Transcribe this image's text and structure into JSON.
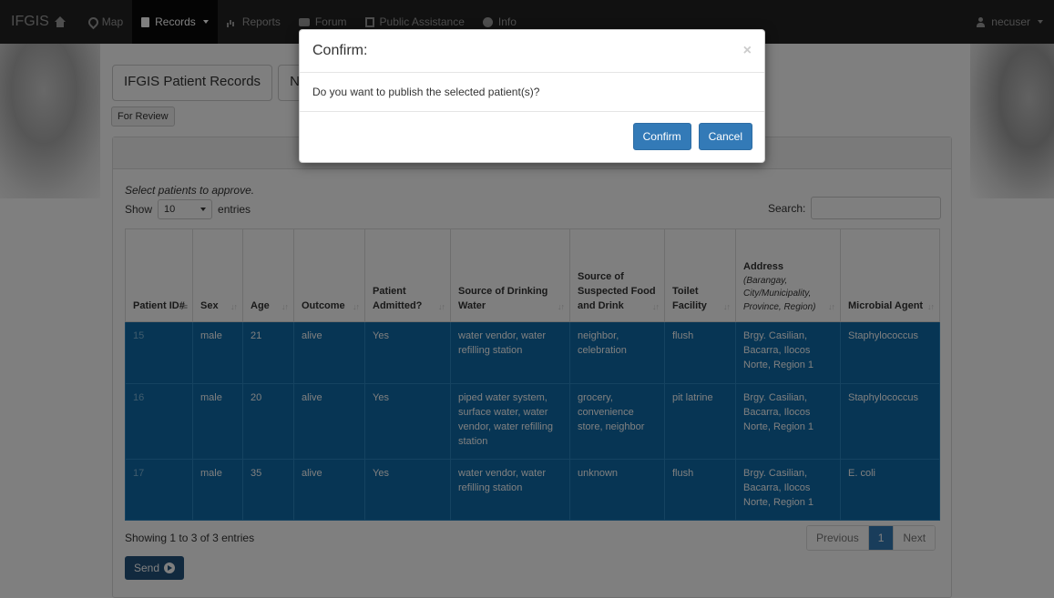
{
  "navbar": {
    "brand": "IFGIS",
    "items": [
      {
        "label": "Map",
        "icon": "map-marker-icon"
      },
      {
        "label": "Records",
        "icon": "book-icon"
      },
      {
        "label": "Reports",
        "icon": "bar-chart-icon"
      },
      {
        "label": "Forum",
        "icon": "comment-icon"
      },
      {
        "label": "Public Assistance",
        "icon": "list-alt-icon"
      },
      {
        "label": "Info",
        "icon": "question-sign-icon"
      }
    ],
    "user": "necuser"
  },
  "page": {
    "tabs": [
      "IFGIS Patient Records",
      "N"
    ],
    "for_review": "For Review",
    "hint": "Select patients to approve.",
    "show_label": "Show",
    "entries_value": "10",
    "entries_label": "entries",
    "search_label": "Search:"
  },
  "table": {
    "headers": [
      {
        "label": "Patient ID#",
        "sub": ""
      },
      {
        "label": "Sex",
        "sub": ""
      },
      {
        "label": "Age",
        "sub": ""
      },
      {
        "label": "Outcome",
        "sub": ""
      },
      {
        "label": "Patient Admitted?",
        "sub": ""
      },
      {
        "label": "Source of Drinking Water",
        "sub": ""
      },
      {
        "label": "Source of Suspected Food and Drink",
        "sub": ""
      },
      {
        "label": "Toilet Facility",
        "sub": ""
      },
      {
        "label": "Address",
        "sub": "(Barangay, City/Municipality, Province, Region)"
      },
      {
        "label": "Microbial Agent",
        "sub": ""
      }
    ],
    "rows": [
      [
        "15",
        "male",
        "21",
        "alive",
        "Yes",
        "water vendor, water refilling station",
        "neighbor, celebration",
        "flush",
        "Brgy. Casilian, Bacarra, Ilocos Norte, Region 1",
        "Staphylococcus"
      ],
      [
        "16",
        "male",
        "20",
        "alive",
        "Yes",
        "piped water system, surface water, water vendor, water refilling station",
        "grocery, convenience store, neighbor",
        "pit latrine",
        "Brgy. Casilian, Bacarra, Ilocos Norte, Region 1",
        "Staphylococcus"
      ],
      [
        "17",
        "male",
        "35",
        "alive",
        "Yes",
        "water vendor, water refilling station",
        "unknown",
        "flush",
        "Brgy. Casilian, Bacarra, Ilocos Norte, Region 1",
        "E. coli"
      ]
    ]
  },
  "footer": {
    "showing": "Showing 1 to 3 of 3 entries",
    "previous": "Previous",
    "current_page": "1",
    "next": "Next",
    "send": "Send"
  },
  "modal": {
    "title": "Confirm:",
    "close": "×",
    "message": "Do you want to publish the selected patient(s)?",
    "confirm": "Confirm",
    "cancel": "Cancel"
  },
  "colors": {
    "selected_row": "#0e6ba8",
    "primary": "#337ab7",
    "navbar": "#222222"
  }
}
